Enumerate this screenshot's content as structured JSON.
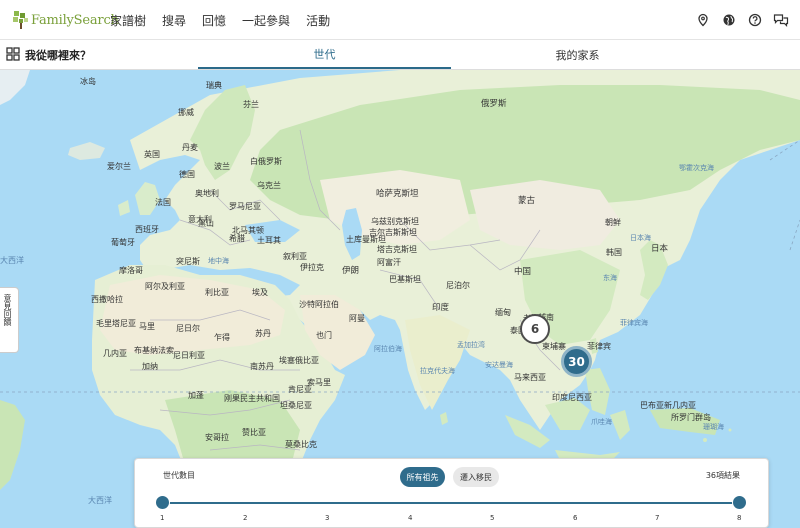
{
  "brand": {
    "name": "FamilySearch",
    "accent": "#2f6c8c",
    "logo_green": "#7aa03a"
  },
  "nav": {
    "links": [
      "家譜樹",
      "搜尋",
      "回憶",
      "一起參與",
      "活動"
    ],
    "icons": [
      "location-pin-icon",
      "globe-icon",
      "help-icon",
      "chat-icon"
    ]
  },
  "subbar": {
    "title": "我從哪裡來？",
    "tabs": [
      {
        "label": "世代",
        "active": true
      },
      {
        "label": "我的家系",
        "active": false
      }
    ]
  },
  "map": {
    "country_labels": [
      "冰岛",
      "瑞典",
      "芬兰",
      "挪威",
      "俄罗斯",
      "丹麦",
      "英国",
      "爱尔兰",
      "波兰",
      "德国",
      "白俄罗斯",
      "乌克兰",
      "奥地利",
      "法国",
      "罗马尼亚",
      "意大利",
      "西班牙",
      "葡萄牙",
      "希腊",
      "土耳其",
      "摩洛哥",
      "突尼斯",
      "阿尔及利亚",
      "利比亚",
      "埃及",
      "叙利亚",
      "伊拉克",
      "伊朗",
      "沙特阿拉伯",
      "也门",
      "阿曼",
      "哈萨克斯坦",
      "乌兹别克斯坦",
      "土库曼斯坦",
      "阿富汗",
      "巴基斯坦",
      "印度",
      "尼泊尔",
      "蒙古",
      "中国",
      "朝鲜",
      "韩国",
      "日本",
      "缅甸",
      "泰国",
      "越南",
      "老挝",
      "柬埔寨",
      "菲律宾",
      "马来西亚",
      "印度尼西亚",
      "西撒哈拉",
      "毛里塔尼亚",
      "马里",
      "尼日尔",
      "乍得",
      "苏丹",
      "南苏丹",
      "埃塞俄比亚",
      "索马里",
      "肯尼亚",
      "尼日利亚",
      "布基纳法索",
      "几内亚",
      "加纳",
      "加蓬",
      "刚果民主共和国",
      "坦桑尼亚",
      "安哥拉",
      "赞比亚",
      "莫桑比克",
      "吉尔吉斯斯坦",
      "塔吉克斯坦",
      "巴布亚新几内亚",
      "所罗门群岛",
      "北马其顿",
      "黑山"
    ],
    "sea_labels": [
      "地中海",
      "阿拉伯海",
      "孟加拉湾",
      "南海",
      "东海",
      "日本海",
      "鄂霍次克海",
      "菲律宾海",
      "爪哇海",
      "珊瑚海",
      "拉克代夫海",
      "安达曼海",
      "里海",
      "黑海"
    ],
    "ocean_labels": [
      "大西洋",
      "大西洋"
    ],
    "clusters": [
      {
        "count": "6",
        "style": "outline"
      },
      {
        "count": "30",
        "style": "filled"
      }
    ],
    "side_tab": "意見回饋"
  },
  "panel": {
    "generation_label": "世代數目",
    "chips": [
      {
        "label": "所有祖先",
        "active": true
      },
      {
        "label": "遷入移民",
        "active": false
      }
    ],
    "results": "36項結果",
    "slider": {
      "min": "1",
      "max": "8",
      "ticks": [
        "1",
        "2",
        "3",
        "4",
        "5",
        "6",
        "7",
        "8"
      ],
      "selected_range": [
        1,
        8
      ]
    }
  }
}
